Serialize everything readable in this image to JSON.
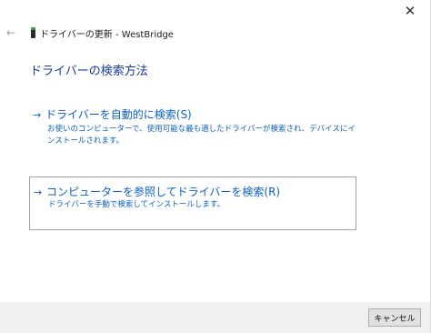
{
  "window": {
    "close_glyph": "✕"
  },
  "titlebar": {
    "back_glyph": "←",
    "title": "ドライバーの更新 - WestBridge"
  },
  "main": {
    "heading": "ドライバーの検索方法",
    "options": [
      {
        "arrow": "→",
        "title": "ドライバーを自動的に検索(S)",
        "description": "お使いのコンピューターで、使用可能な最も適したドライバーが検索され、デバイスにインストールされます。"
      },
      {
        "arrow": "→",
        "title": "コンピューターを参照してドライバーを検索(R)",
        "description": "ドライバーを手動で検索してインストールします。"
      }
    ]
  },
  "footer": {
    "cancel_label": "キャンセル"
  },
  "colors": {
    "heading": "#163b9b",
    "link": "#0b61c4",
    "footer_bg": "#f0f0f0",
    "device_icon_accent": "#3f9b3f"
  },
  "icons": {
    "back": "back-arrow-icon",
    "device": "device-icon",
    "close": "close-icon"
  }
}
